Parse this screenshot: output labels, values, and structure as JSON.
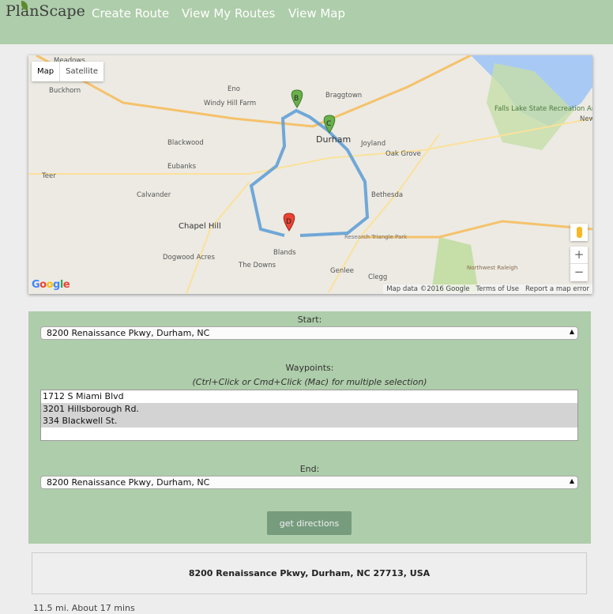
{
  "nav": {
    "logo": "PlanScape",
    "links": [
      "Create Route",
      "View My Routes",
      "View Map"
    ]
  },
  "map": {
    "type_buttons": [
      "Map",
      "Satellite"
    ],
    "places": [
      "Meadows",
      "Buckhorn",
      "Eno",
      "Windy Hill Farm",
      "Braggtown",
      "Blackwood",
      "Durham",
      "Joyland",
      "Oak Grove",
      "Eubanks",
      "Teer",
      "Calvander",
      "Bethesda",
      "Chapel Hill",
      "Dogwood Acres",
      "The Downs",
      "Blands",
      "Genlee",
      "Clegg",
      "Falls Lake State Recreation Area",
      "Research Triangle Park",
      "Northwest Raleigh",
      "New"
    ],
    "markers": [
      "B",
      "C",
      "D"
    ],
    "zoom_in": "+",
    "zoom_out": "−",
    "google_logo": "Google",
    "attribution": [
      "Map data ©2016 Google",
      "Terms of Use",
      "Report a map error"
    ],
    "route_color": "#5b9bd5"
  },
  "form": {
    "start_label": "Start:",
    "start_value": "8200 Renaissance Pkwy, Durham, NC",
    "waypoints_label": "Waypoints:",
    "waypoints_hint": "(Ctrl+Click or Cmd+Click (Mac) for multiple selection)",
    "waypoints": [
      {
        "label": "1712 S Miami Blvd",
        "selected": false
      },
      {
        "label": "3201 Hillsborough Rd.",
        "selected": true
      },
      {
        "label": "334 Blackwell St.",
        "selected": true
      }
    ],
    "end_label": "End:",
    "end_value": "8200 Renaissance Pkwy, Durham, NC",
    "submit": "get directions"
  },
  "result": {
    "address": "8200 Renaissance Pkwy, Durham, NC 27713, USA",
    "summary": "11.5 mi. About 17 mins"
  }
}
